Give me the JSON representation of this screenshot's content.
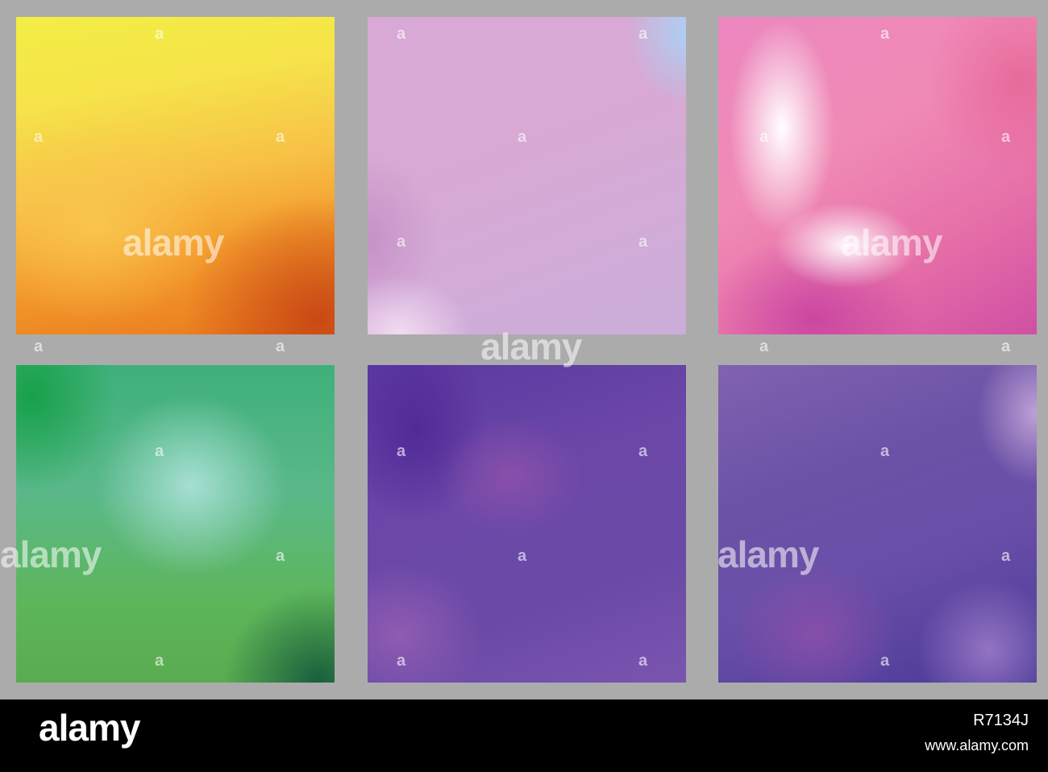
{
  "watermark": {
    "word": "alamy",
    "mark": "a"
  },
  "tiles": [
    {
      "name": "yellow-orange-gradient"
    },
    {
      "name": "lavender-pink-gradient"
    },
    {
      "name": "pink-white-swirl"
    },
    {
      "name": "green-teal-gradient"
    },
    {
      "name": "purple-swirl"
    },
    {
      "name": "violet-swirl"
    }
  ],
  "footer": {
    "logo": "alamy",
    "image_id": "R7134J",
    "url": "www.alamy.com"
  },
  "colors": {
    "background": "#ababab",
    "footer": "#000000",
    "text": "#ffffff"
  }
}
